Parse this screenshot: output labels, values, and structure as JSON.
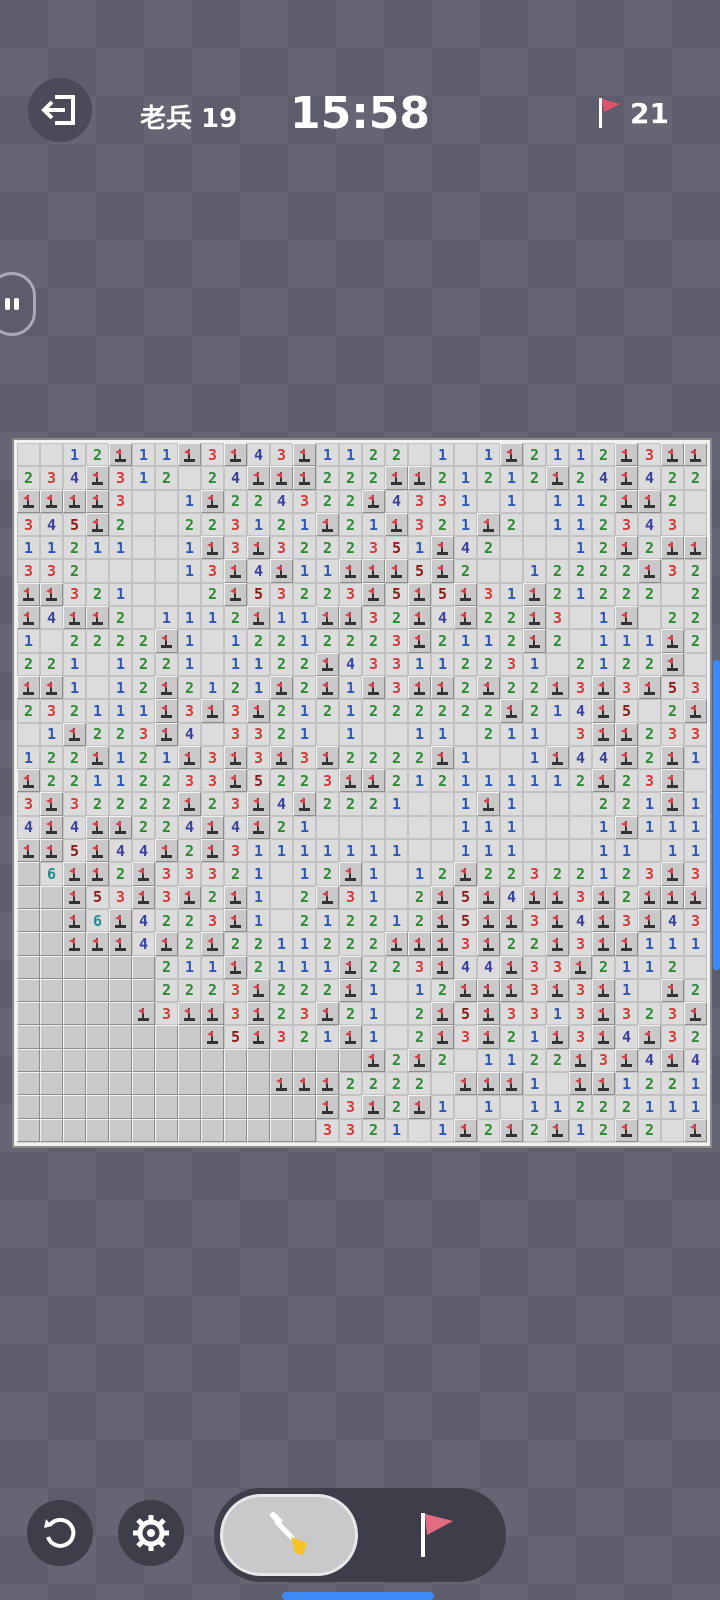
{
  "header": {
    "level_label": "老兵 19",
    "timer": "15:58",
    "flags_remaining": "21"
  },
  "board": {
    "cols": 30,
    "rows": 30,
    "legend": "o=closed, F=flag, digits=open number, space=open empty",
    "number_colors": {
      "1": "#2f58b5",
      "2": "#2f8a35",
      "3": "#d43b3b",
      "4": "#3b3f9e",
      "5": "#8e1b1b",
      "6": "#1f8e8e"
    },
    "flag_color": "#d8404f",
    "grid": [
      "  12F11F3F43F1122 1 1F2112F3FF",
      "234F312 24FFF222FF21212F24F422",
      "FFFF3  1F224322F4331 1 112FF2 ",
      "345F2  223121F21F321F2 112343 ",
      "11211  1F3F3222351F42   12F2FF",
      "332    13F4F11FFF5F2  12222F32",
      "FF321   2F53223F5F5F31F21222 2",
      "F4FF2 1112F11FF32F4F22F3 1F 22",
      "1 2222F1 12212223F2112F2 111F2",
      "221 1221 1122F433112231 2122F ",
      "FF1 12F2121F2F1F3FF2F22F3F3F53",
      "232111F3F3F2121222222F214F5 2F",
      " 1F223F4 3321 1  11 211 3FF233",
      "122F121F3F3F3F2222F1  1F44F2F1",
      "F22112233F5223FF212111112F23F ",
      "3F32222F23F4F2221  1F1   221F1",
      "4F4FF224F4F21      111   1F111",
      "FF5F44F2F31111111  111   11 11",
      "o6FF2F33321 12F1 12F22322123F3",
      "ooF53F3F2F1 2F31 2F5F4FF3F2FFF",
      "ooF6F4223F1 212212F5FF3F4F3F43",
      "ooFFF4F2F2211222FFF3F22F3FF111",
      "oooooo211F2111F223F44F33F2112 ",
      "oooooo2223F222F1 12FFF3F3F1 F2",
      "oooooF3FF3F23F21 2F5F3313F323F",
      "ooooooooF5F321F1 2F3F21F3F4F32",
      "oooooooooooooooF2F2 1122F3F4F4",
      "oooooooooooFFF2222 FFF1 FF1221",
      "oooooooooooooF3F2F1 1 11222111",
      "ooooooooooooo3321 1F2F2F12F2 F"
    ]
  },
  "controls": {
    "restart": "restart",
    "settings": "settings",
    "mode_dig": "dig",
    "mode_flag": "flag"
  }
}
